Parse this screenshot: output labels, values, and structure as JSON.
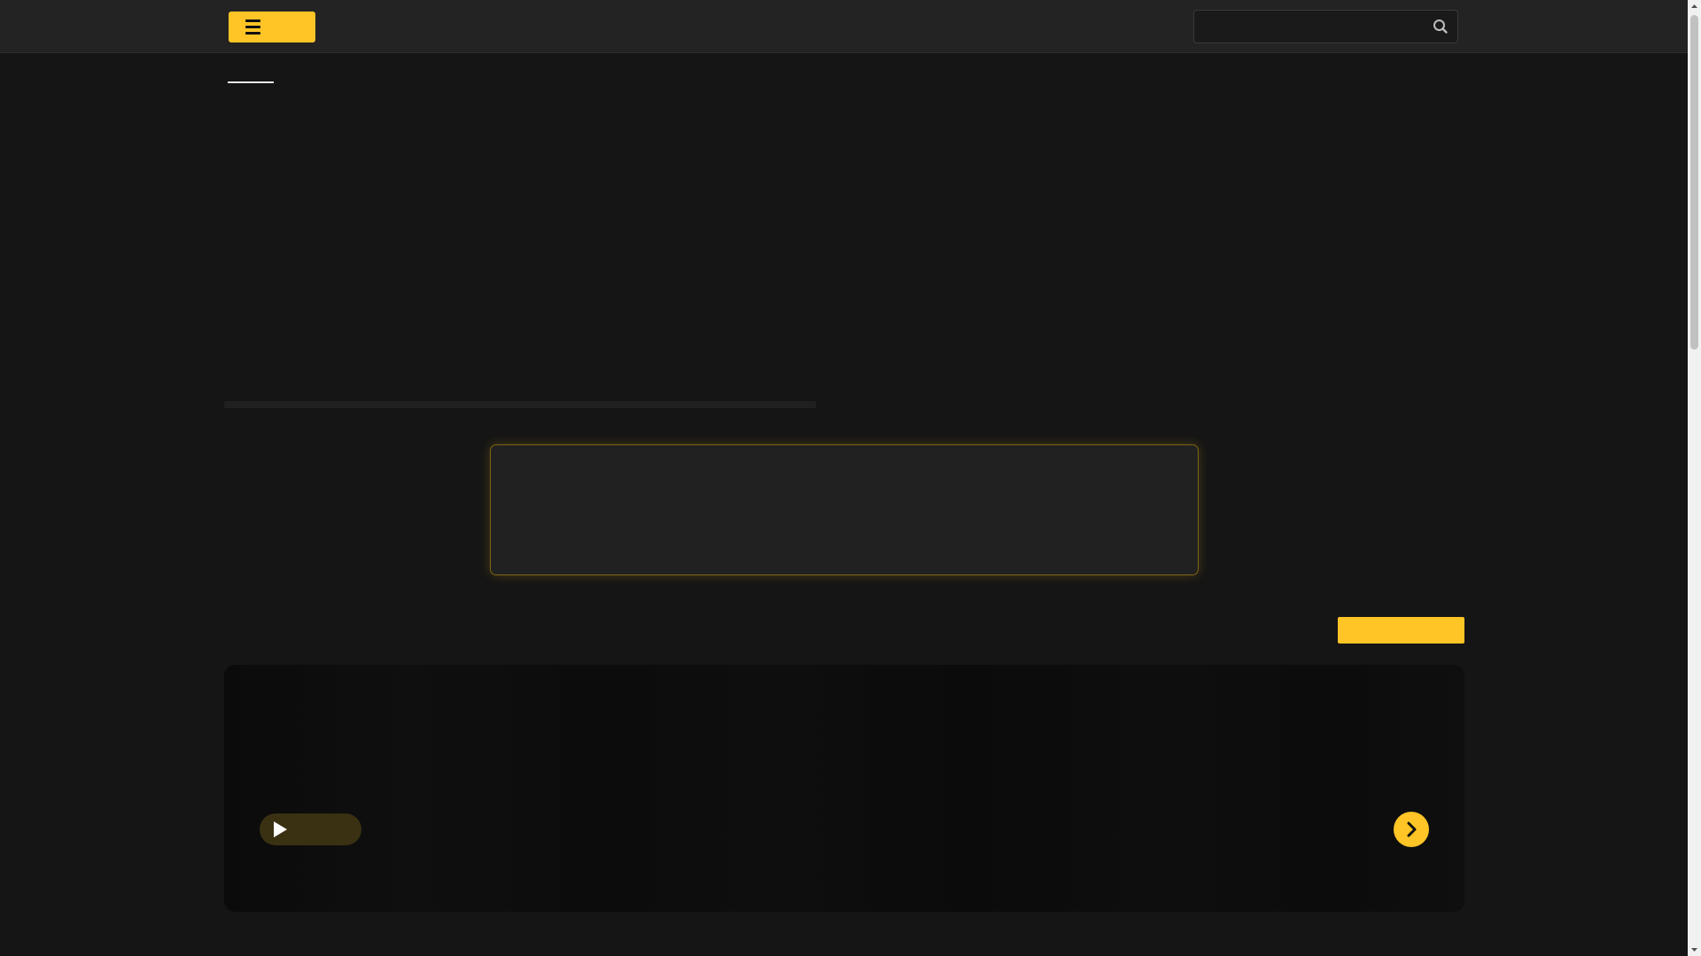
{
  "colors": {
    "accent": "#ffc425",
    "header_bg": "#222322",
    "page_bg": "#151515"
  },
  "header": {
    "menu_button": {
      "label": "",
      "icon": "hamburger-icon"
    },
    "search": {
      "placeholder": "",
      "value": "",
      "icon": "search-icon"
    }
  },
  "tabs": {
    "active_label": ""
  },
  "hero": {
    "title": ""
  },
  "progress": {
    "fraction": 1.0
  },
  "notice": {
    "text": ""
  },
  "section": {
    "title": "",
    "see_all_label": ""
  },
  "slider": {
    "play_label": "",
    "play_icon": "play-icon",
    "next_icon": "chevron-right-icon"
  }
}
